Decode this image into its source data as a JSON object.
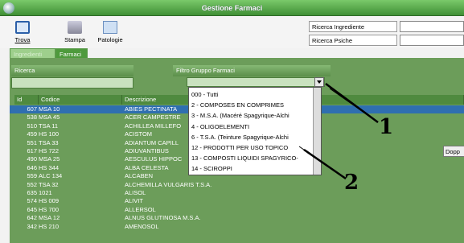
{
  "window": {
    "title": "Gestione Farmaci"
  },
  "toolbar": {
    "trova": "Trova",
    "stampa": "Stampa",
    "patologie": "Patologie"
  },
  "right": {
    "ricerca_ingrediente": "Ricerca Ingrediente",
    "ricerca_psiche": "Ricerca Psiche"
  },
  "tabs": [
    "Ingredienti",
    "Farmaci"
  ],
  "search": {
    "label": "Ricerca",
    "filter_label": "Filtro Gruppo Farmaci"
  },
  "grid": {
    "headers": [
      "Id",
      "Codice",
      "Descrizione"
    ],
    "rows": [
      {
        "id": "607",
        "code": "MSA 10",
        "desc": "ABIES PECTINATA"
      },
      {
        "id": "538",
        "code": "MSA 45",
        "desc": "ACER CAMPESTRE"
      },
      {
        "id": "510",
        "code": "TSA 11",
        "desc": "ACHILLEA MILLEFO"
      },
      {
        "id": "459",
        "code": "HS 100",
        "desc": "ACISTOM"
      },
      {
        "id": "551",
        "code": "TSA 33",
        "desc": "ADIANTUM CAPILL"
      },
      {
        "id": "617",
        "code": "HS 722",
        "desc": "ADIUVANTIBUS"
      },
      {
        "id": "490",
        "code": "MSA 25",
        "desc": "AESCULUS HIPPOC"
      },
      {
        "id": "646",
        "code": "HS 344",
        "desc": "ALBA CELESTA"
      },
      {
        "id": "559",
        "code": "ALC 134",
        "desc": "ALCABEN"
      },
      {
        "id": "552",
        "code": "TSA 32",
        "desc": "ALCHEMILLA VULGARIS T.S.A."
      },
      {
        "id": "635",
        "code": "1021",
        "desc": "ALISOL"
      },
      {
        "id": "574",
        "code": "HS 009",
        "desc": "ALIVIT"
      },
      {
        "id": "645",
        "code": "HS 700",
        "desc": "ALLERSOL"
      },
      {
        "id": "642",
        "code": "MSA 12",
        "desc": "ALNUS GLUTINOSA M.S.A."
      },
      {
        "id": "342",
        "code": "HS 210",
        "desc": "AMENOSOL"
      }
    ]
  },
  "dropdown": {
    "items": [
      "000 - Tutti",
      "2 - COMPOSES EN COMPRIMES",
      "3 - M.S.A. (Macéré Spagyrique-Alchi",
      "4 - OLIGOELEMENTI",
      "6 - T.S.A. (Teinture Spagyrique-Alchi",
      "12 - PRODOTTI PER USO TOPICO",
      "13 - COMPOSTI LIQUIDI SPAGYRICO-",
      "14 - SCIROPPI"
    ]
  },
  "annotations": {
    "one": "1",
    "two": "2"
  },
  "side_button": "Dopp"
}
